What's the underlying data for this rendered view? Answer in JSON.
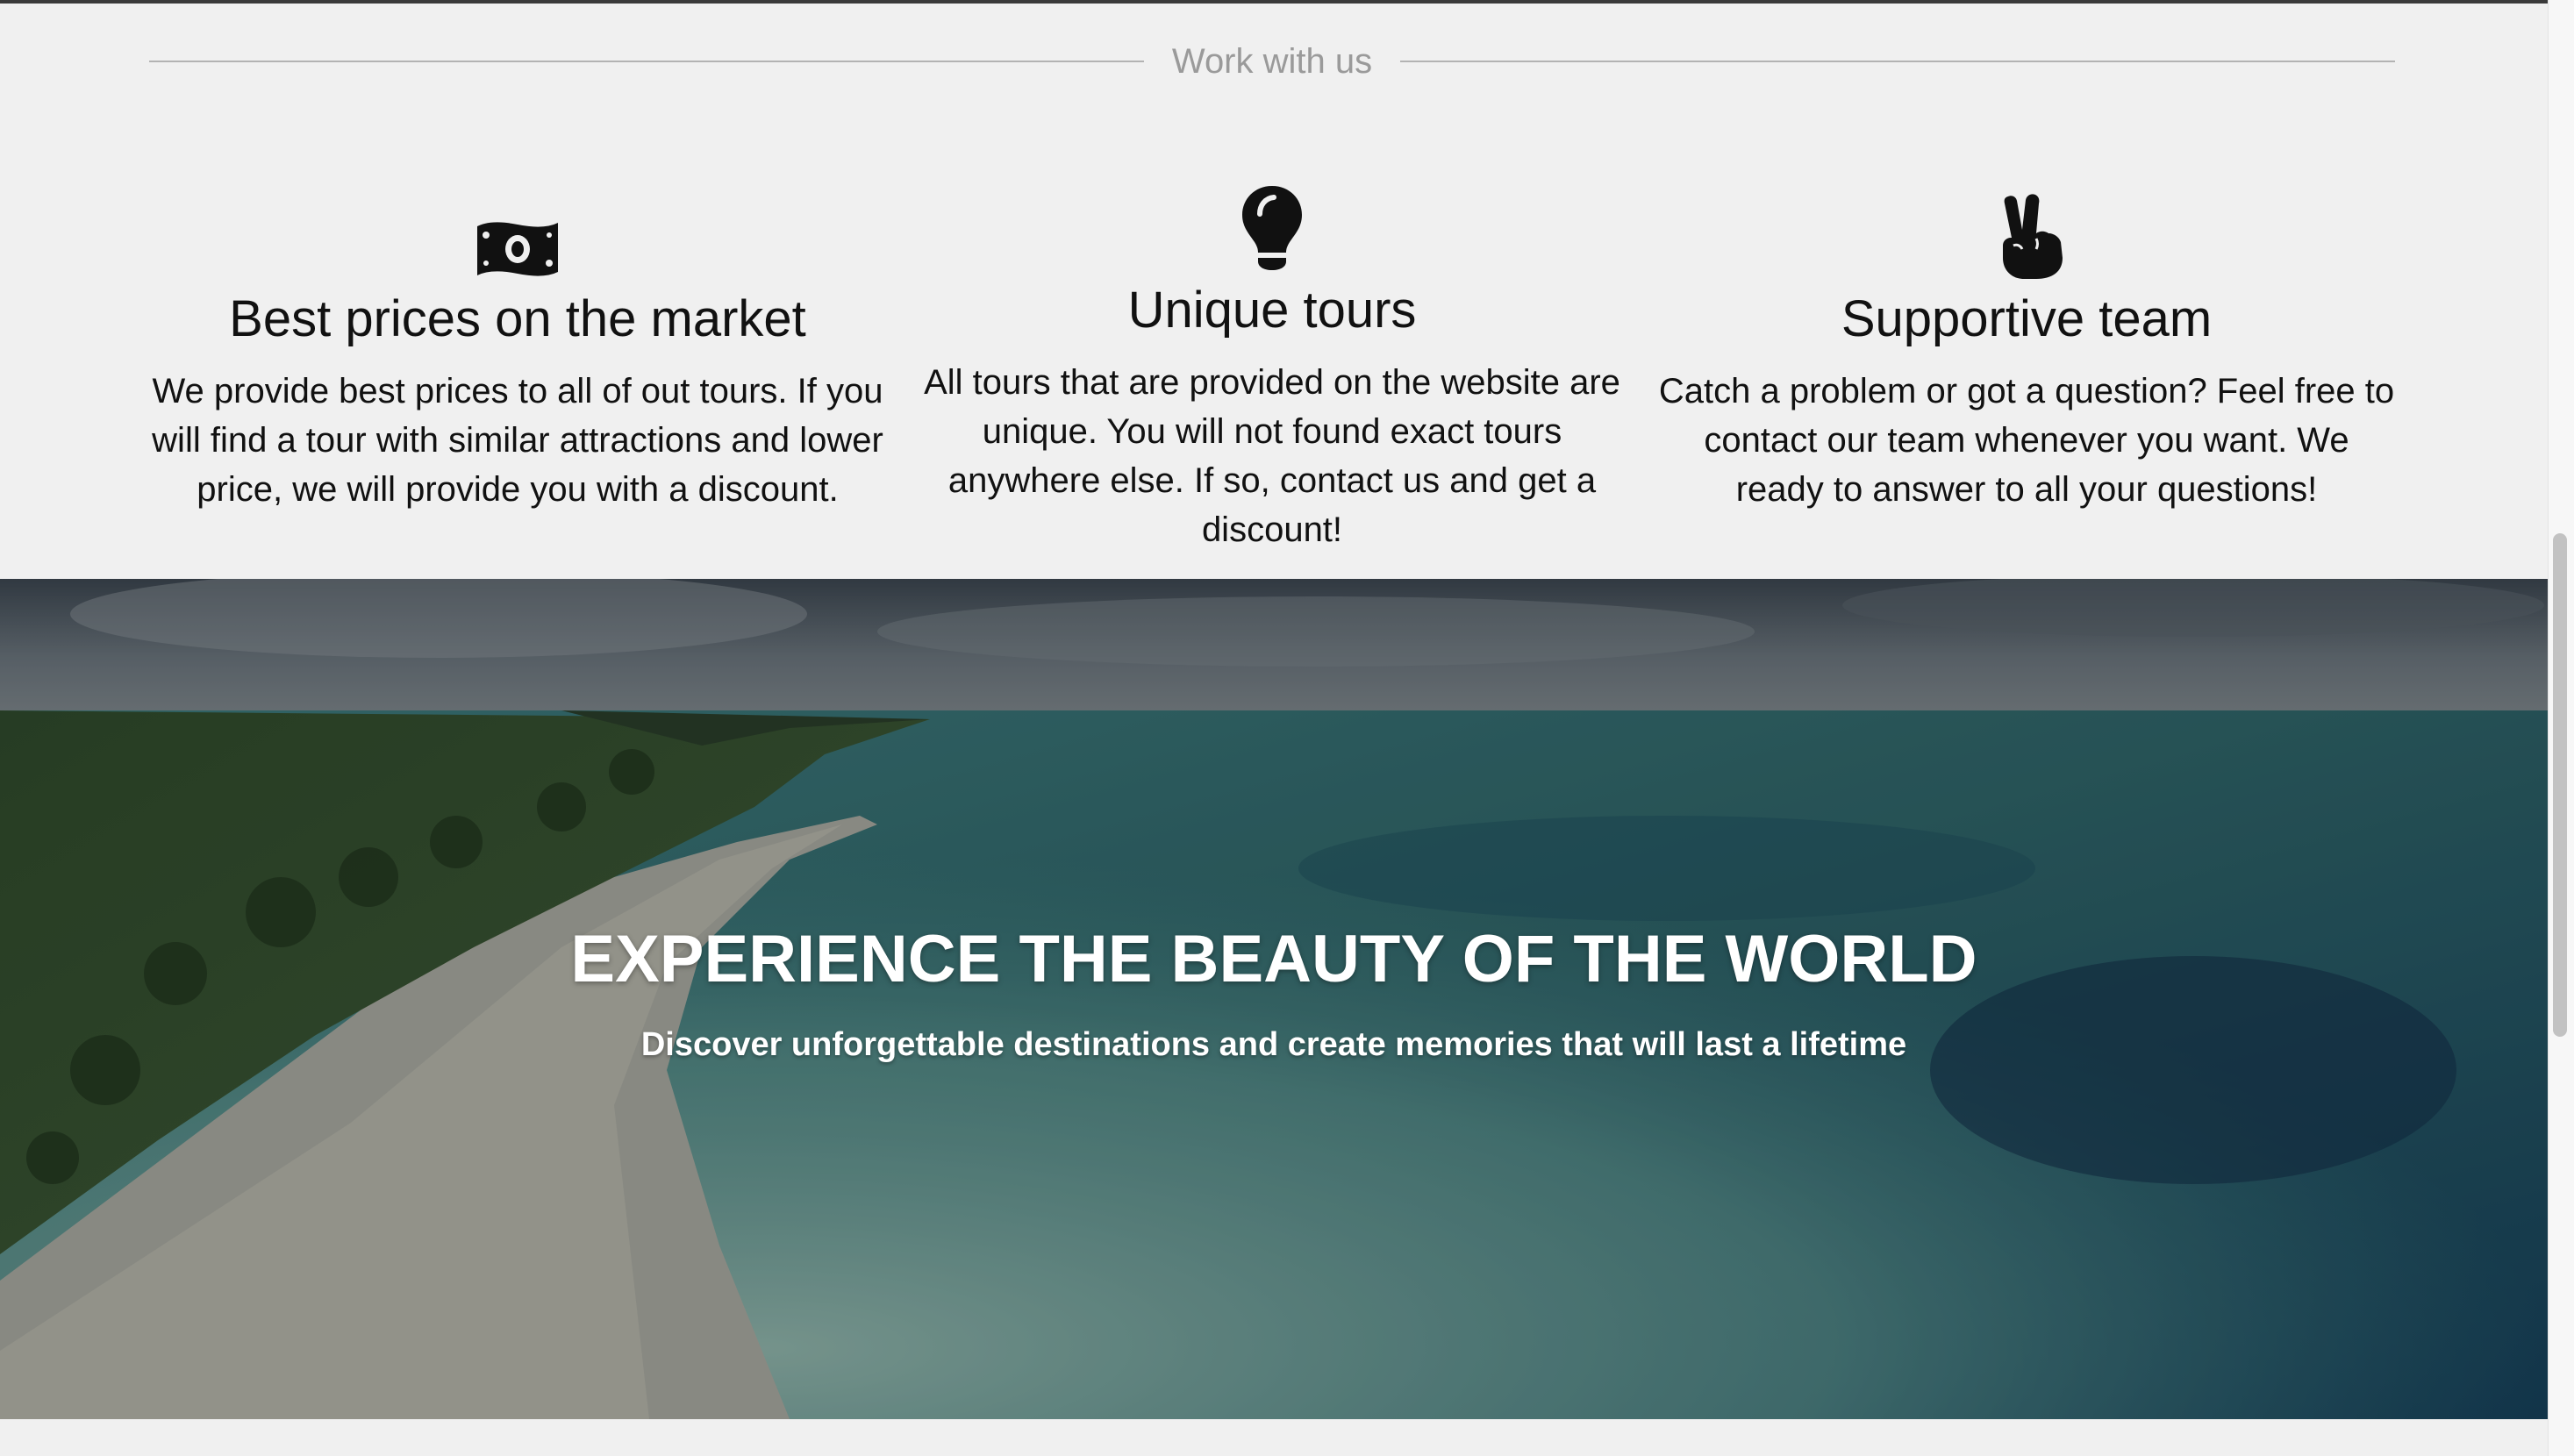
{
  "section": {
    "heading": "Work with us"
  },
  "features": [
    {
      "icon": "money-bill-icon",
      "title": "Best prices on the market",
      "description": "We provide best prices to all of out tours. If you will find a tour with similar attractions and lower price, we will provide you with a discount."
    },
    {
      "icon": "lightbulb-icon",
      "title": "Unique tours",
      "description": "All tours that are provided on the website are unique. You will not found exact tours anywhere else. If so, contact us and get a discount!"
    },
    {
      "icon": "peace-hand-icon",
      "title": "Supportive team",
      "description": "Catch a problem or got a question? Feel free to contact our team whenever you want. We ready to answer to all your questions!"
    }
  ],
  "hero": {
    "title": "EXPERIENCE THE BEAUTY OF THE WORLD",
    "subtitle": "Discover unforgettable destinations and create memories that will last a lifetime",
    "image": "beach-aerial-photo"
  },
  "colors": {
    "background": "#f0f0f0",
    "text": "#111111",
    "muted": "#9a9a9a",
    "hero_text": "#ffffff"
  }
}
